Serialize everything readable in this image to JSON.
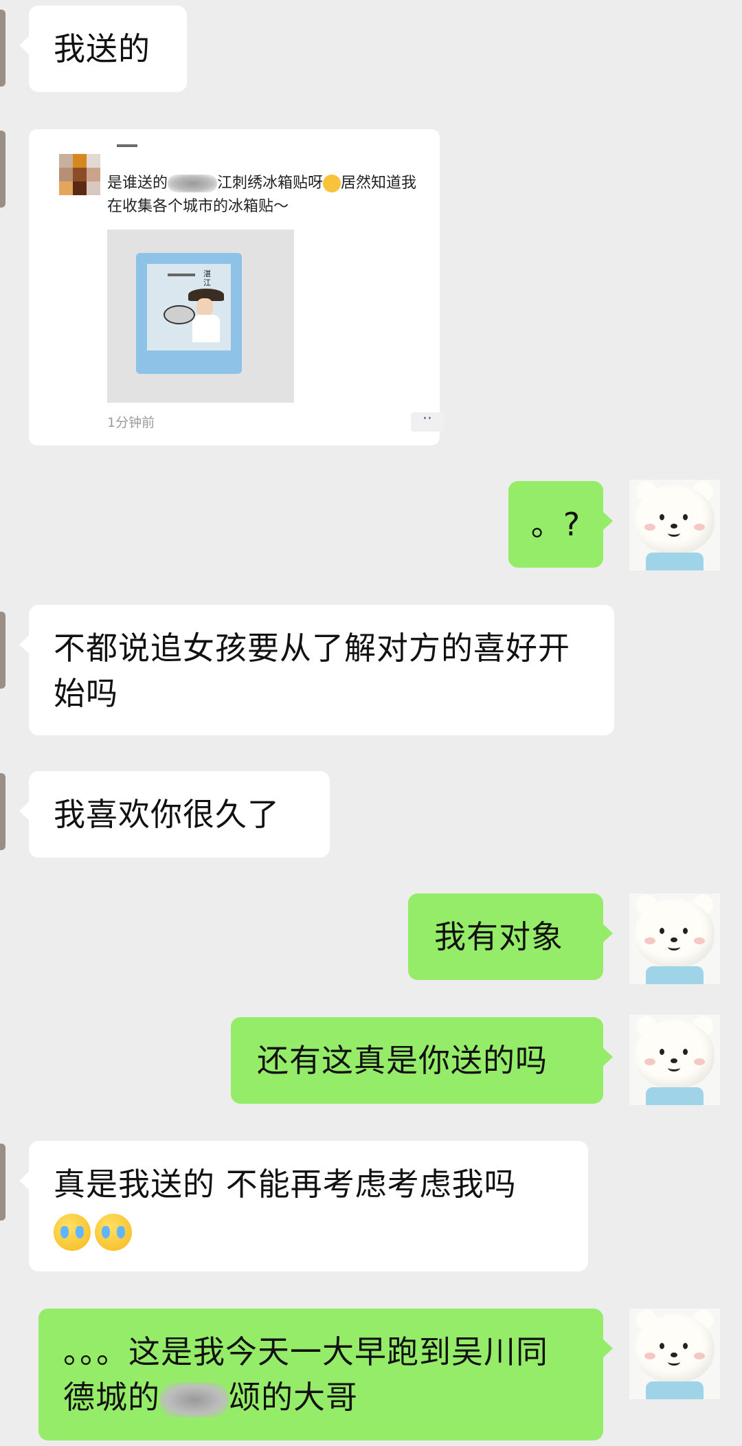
{
  "messages": [
    {
      "side": "left",
      "text": "我送的"
    },
    {
      "side": "left",
      "type": "moments_card",
      "post_prefix": "是谁送的",
      "post_suffix": "江刺绣冰箱贴呀",
      "post_tail": "居然知道我在收集各个城市的冰箱贴～",
      "stamp_caption": "湛江",
      "time": "1分钟前",
      "more": "··"
    },
    {
      "side": "right",
      "text": "。?"
    },
    {
      "side": "left",
      "text": "不都说追女孩要从了解对方的喜好开始吗"
    },
    {
      "side": "left",
      "text": "我喜欢你很久了"
    },
    {
      "side": "right",
      "text": "我有对象"
    },
    {
      "side": "right",
      "text": "还有这真是你送的吗"
    },
    {
      "side": "left",
      "text": "真是我送的 不能再考虑考虑我吗",
      "emojis": [
        "cry-emoji",
        "cry-emoji"
      ]
    },
    {
      "side": "right",
      "text_a": "。。。这是我今天一大早跑到吴川同德城的",
      "text_b": "颂的大哥"
    }
  ],
  "colors": {
    "background": "#ededed",
    "left_bubble": "#ffffff",
    "right_bubble": "#95ec69"
  },
  "icons": {
    "self_avatar": "polar-bear-avatar",
    "emoji": "crying-face-emoji"
  }
}
